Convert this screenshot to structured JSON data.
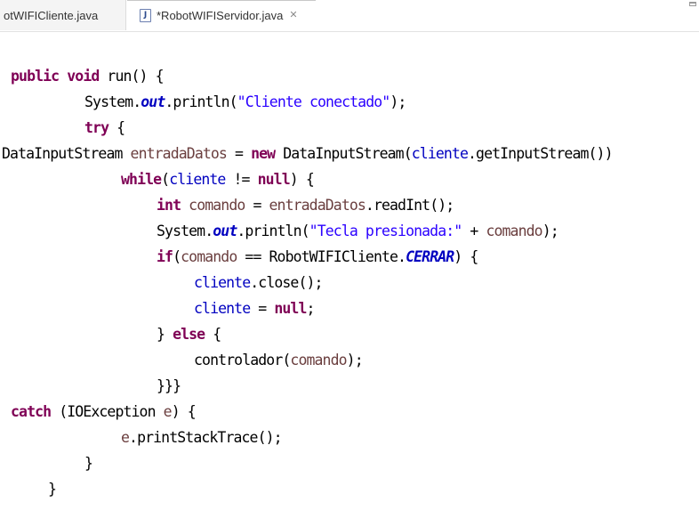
{
  "tabs": {
    "inactive_label": "otWIFICliente.java",
    "active_icon": "java-file-icon",
    "active_label": "*RobotWIFIServidor.java",
    "close_glyph": "✕"
  },
  "code": {
    "l1": {
      "kw_public": "public",
      "kw_void": "void",
      "rest": " run() {"
    },
    "l2": {
      "a": "System.",
      "out": "out",
      "b": ".println(",
      "str": "\"Cliente conectado\"",
      "c": ");"
    },
    "l3": {
      "kw_try": "try",
      "rest": " {"
    },
    "l4": {
      "a": "DataInputStream ",
      "var": "entradaDatos",
      "b": " = ",
      "kw_new": "new",
      "c": " DataInputStream(",
      "field": "cliente",
      "d": ".getInputStream())"
    },
    "l5": {
      "kw_while": "while",
      "a": "(",
      "field": "cliente",
      "b": " != ",
      "kw_null": "null",
      "c": ") {"
    },
    "l6": {
      "kw_int": "int",
      "a": " ",
      "var": "comando",
      "b": " = ",
      "var2": "entradaDatos",
      "c": ".readInt();"
    },
    "l7": {
      "a": "System.",
      "out": "out",
      "b": ".println(",
      "str": "\"Tecla presionada:\"",
      "c": " + ",
      "var": "comando",
      "d": ");"
    },
    "l8": {
      "kw_if": "if",
      "a": "(",
      "var": "comando",
      "b": " == RobotWIFICliente.",
      "const": "CERRAR",
      "c": ") {"
    },
    "l9": {
      "field": "cliente",
      "rest": ".close();"
    },
    "l10": {
      "field": "cliente",
      "a": " = ",
      "kw_null": "null",
      "b": ";"
    },
    "l11": {
      "a": "} ",
      "kw_else": "else",
      "b": " {"
    },
    "l12": {
      "a": "controlador(",
      "var": "comando",
      "b": ");"
    },
    "l13": {
      "text": "}}}"
    },
    "l14": {
      "kw_catch": "catch",
      "a": " (IOException ",
      "var": "e",
      "b": ") {"
    },
    "l15": {
      "var": "e",
      "rest": ".printStackTrace();"
    },
    "l16": {
      "text": "}"
    },
    "l17": {
      "text": "}"
    }
  },
  "colors": {
    "keyword": "#7f0055",
    "string": "#2a00ff",
    "field": "#0000c0",
    "local_variable": "#6a3e3e"
  }
}
